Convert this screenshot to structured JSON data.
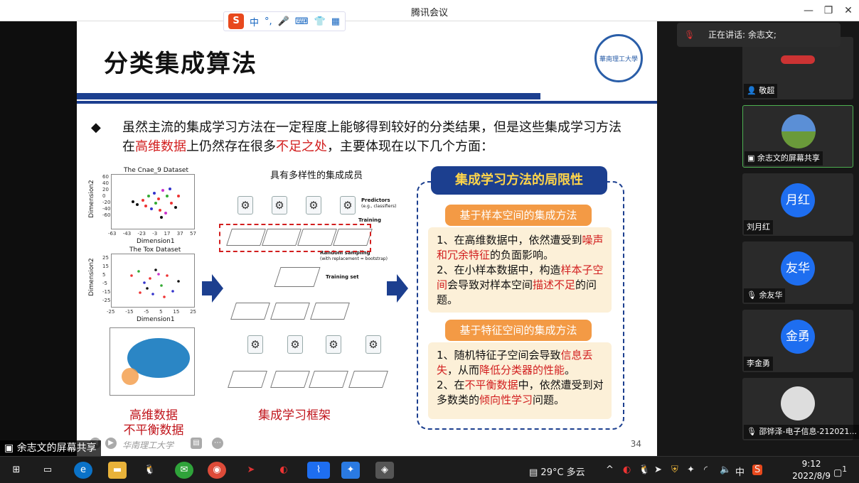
{
  "window": {
    "title": "腾讯会议",
    "minimize": "—",
    "restore": "❐",
    "close": "✕"
  },
  "ime": {
    "logo": "S",
    "lang": "中",
    "punct": "°,",
    "mic": "🎤",
    "keyboard": "⌨",
    "skin": "👕",
    "apps": "▦"
  },
  "slide": {
    "title": "分类集成算法",
    "emblem": "華南理工大學",
    "bullet_symbol": "◆",
    "bullet_parts": [
      "虽然主流的集成学习方法在一定程度上能够得到较好的分类结果，但是这些集成学习方法在",
      "高维数据",
      "上仍然存在很多",
      "不足之处",
      "，主要体现在以下几个方面："
    ],
    "plots": {
      "p1_title": "The Cnae_9 Dataset",
      "p1_ylabel": "Dimension2",
      "p1_xlabel": "Dimension1",
      "p1_xticks": [
        "-63",
        "-43",
        "-23",
        "-3",
        "17",
        "37",
        "57"
      ],
      "p1_yticks": [
        "60",
        "40",
        "20",
        "0",
        "-20",
        "-40",
        "-60"
      ],
      "p2_title": "The Tox Dataset",
      "p2_ylabel": "Dimension2",
      "p2_xlabel": "Dimension1",
      "p2_xticks": [
        "-25",
        "-15",
        "-5",
        "5",
        "15",
        "25"
      ],
      "p2_yticks": [
        "25",
        "15",
        "5",
        "-5",
        "-15",
        "-25"
      ]
    },
    "left_caption_1": "高维数据",
    "left_caption_2": "不平衡数据",
    "framework": {
      "diverse": "具有多样性的集成成员",
      "predictors": "Predictors",
      "predictors_sub": "(e.g., classifiers)",
      "training": "Training",
      "random_sampling": "Random sampling",
      "random_sub": "(with replacement = bootstrap)",
      "training_set": "Training set",
      "caption": "集成学习框架"
    },
    "limits": {
      "title": "集成学习方法的局限性",
      "s1_title": "基于样本空间的集成方法",
      "s1_lines": [
        [
          "1、在高维数据中，依然遭受到",
          ""
        ],
        [
          "",
          "噪声和冗余特征"
        ],
        [
          "的负面影响。",
          ""
        ],
        [
          "2、在小样本数据中，构造",
          ""
        ],
        [
          "",
          "样本子空间"
        ],
        [
          "会导致对样本空间",
          ""
        ],
        [
          "",
          "描述不足"
        ],
        [
          "的问题。",
          ""
        ]
      ],
      "s2_title": "基于特征空间的集成方法",
      "s2_lines": [
        [
          "1、随机特征子空间会导致",
          ""
        ],
        [
          "",
          "信息丢失"
        ],
        [
          "，从而",
          ""
        ],
        [
          "",
          "降低分类器的性能"
        ],
        [
          "。",
          ""
        ],
        [
          "2、在",
          ""
        ],
        [
          "",
          "不平衡数据"
        ],
        [
          "中，依然遭受到对多数类的",
          ""
        ],
        [
          "",
          "倾向性学习"
        ],
        [
          "问题。",
          ""
        ]
      ]
    },
    "footer": {
      "school": "华南理工大学",
      "page": "34"
    }
  },
  "speaking": {
    "text": "正在讲话: 余志文;"
  },
  "participants": [
    {
      "name": "敬超",
      "avatar": ""
    },
    {
      "name": "余志文的屏幕共享",
      "avatar": ""
    },
    {
      "name": "刘月红",
      "avatar": "月红"
    },
    {
      "name": "余友华",
      "avatar": "友华"
    },
    {
      "name": "李金勇",
      "avatar": "金勇"
    },
    {
      "name": "邵铧泽-电子信息-212021...",
      "avatar": ""
    }
  ],
  "share_badge": "余志文的屏幕共享",
  "taskbar": {
    "weather": "29°C 多云",
    "lang": "中",
    "time": "9:12",
    "date": "2022/8/9",
    "notif": "1"
  },
  "colors": {
    "navy": "#1c3f8f",
    "red": "#d21f1f",
    "orange": "#f39a45",
    "zoom_blue": "#1e6ef0"
  }
}
